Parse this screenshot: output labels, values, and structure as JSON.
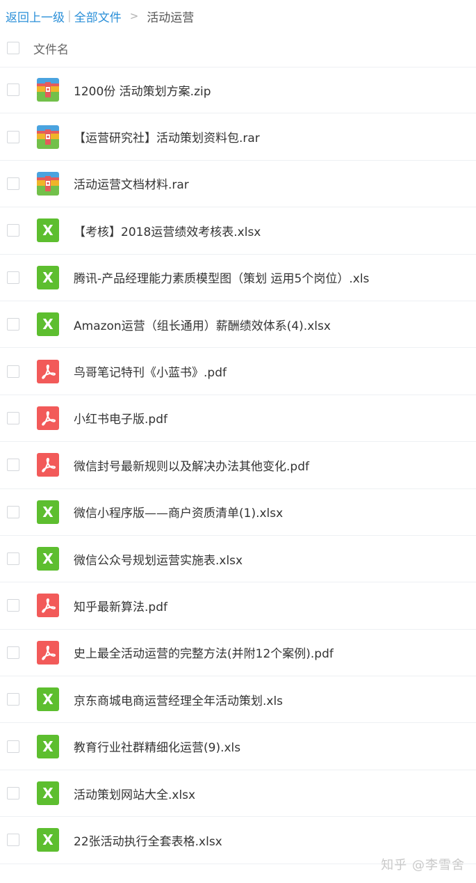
{
  "breadcrumb": {
    "back": "返回上一级",
    "separator": "|",
    "all_files": "全部文件",
    "arrow": ">",
    "current": "活动运营"
  },
  "header": {
    "column_name": "文件名"
  },
  "files": [
    {
      "name": "1200份 活动策划方案.zip",
      "type": "zip"
    },
    {
      "name": "【运营研究社】活动策划资料包.rar",
      "type": "zip"
    },
    {
      "name": "活动运营文档材料.rar",
      "type": "zip"
    },
    {
      "name": "【考核】2018运营绩效考核表.xlsx",
      "type": "xls"
    },
    {
      "name": "腾讯-产品经理能力素质模型图（策划 运用5个岗位）.xls",
      "type": "xls"
    },
    {
      "name": "Amazon运营（组长通用）薪酬绩效体系(4).xlsx",
      "type": "xls"
    },
    {
      "name": "鸟哥笔记特刊《小蓝书》.pdf",
      "type": "pdf"
    },
    {
      "name": "小红书电子版.pdf",
      "type": "pdf"
    },
    {
      "name": "微信封号最新规则以及解决办法其他变化.pdf",
      "type": "pdf"
    },
    {
      "name": "微信小程序版——商户资质清单(1).xlsx",
      "type": "xls"
    },
    {
      "name": "微信公众号规划运营实施表.xlsx",
      "type": "xls"
    },
    {
      "name": "知乎最新算法.pdf",
      "type": "pdf"
    },
    {
      "name": "史上最全活动运营的完整方法(并附12个案例).pdf",
      "type": "pdf"
    },
    {
      "name": "京东商城电商运营经理全年活动策划.xls",
      "type": "xls"
    },
    {
      "name": "教育行业社群精细化运营(9).xls",
      "type": "xls"
    },
    {
      "name": "活动策划网站大全.xlsx",
      "type": "xls"
    },
    {
      "name": "22张活动执行全套表格.xlsx",
      "type": "xls"
    }
  ],
  "icons": {
    "xls": {
      "name": "excel-file-icon",
      "glyph": "X",
      "color": "#5dbe2f"
    },
    "pdf": {
      "name": "pdf-file-icon",
      "color": "#f25a59"
    },
    "zip": {
      "name": "archive-file-icon"
    }
  },
  "watermark": "知乎 @李雪舍"
}
